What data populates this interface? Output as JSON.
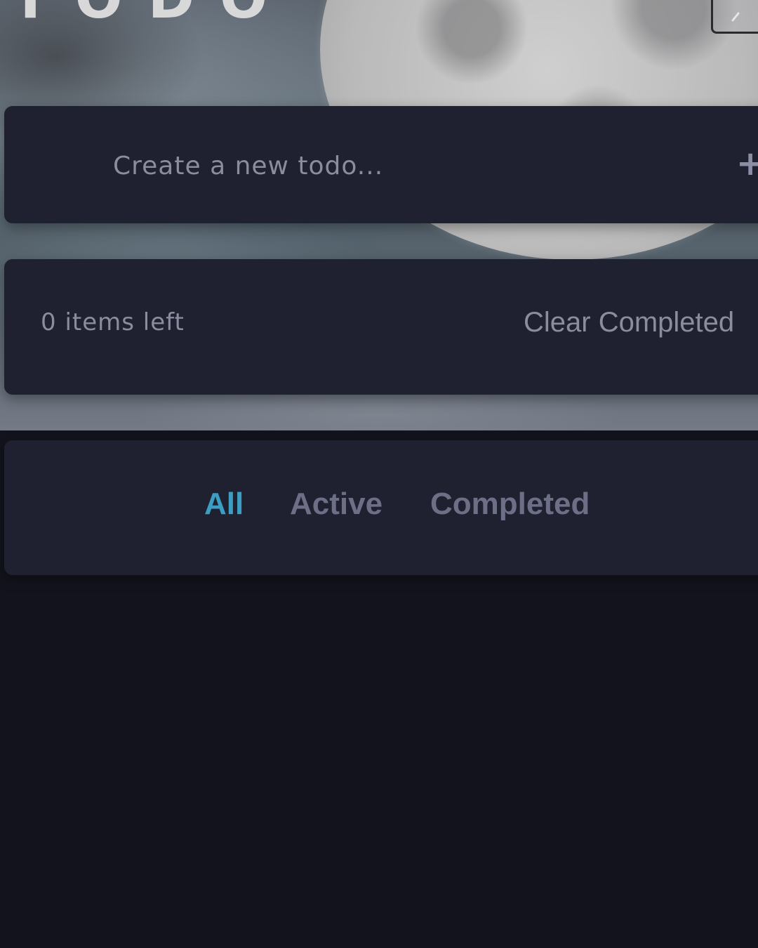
{
  "app": {
    "title": "TODO"
  },
  "create": {
    "placeholder": "Create a new todo...",
    "add_label": "+"
  },
  "status": {
    "items_left": "0 items left",
    "clear_label": "Clear Completed"
  },
  "filters": {
    "all": "All",
    "active": "Active",
    "completed": "Completed",
    "selected": "all"
  },
  "theme": {
    "icon": "theme-toggle-icon"
  },
  "colors": {
    "background": "#13131d",
    "card": "#1f2030",
    "accent": "#3b9ec2",
    "muted_text": "#8b8c9e",
    "filter_text": "#6d6f86"
  }
}
